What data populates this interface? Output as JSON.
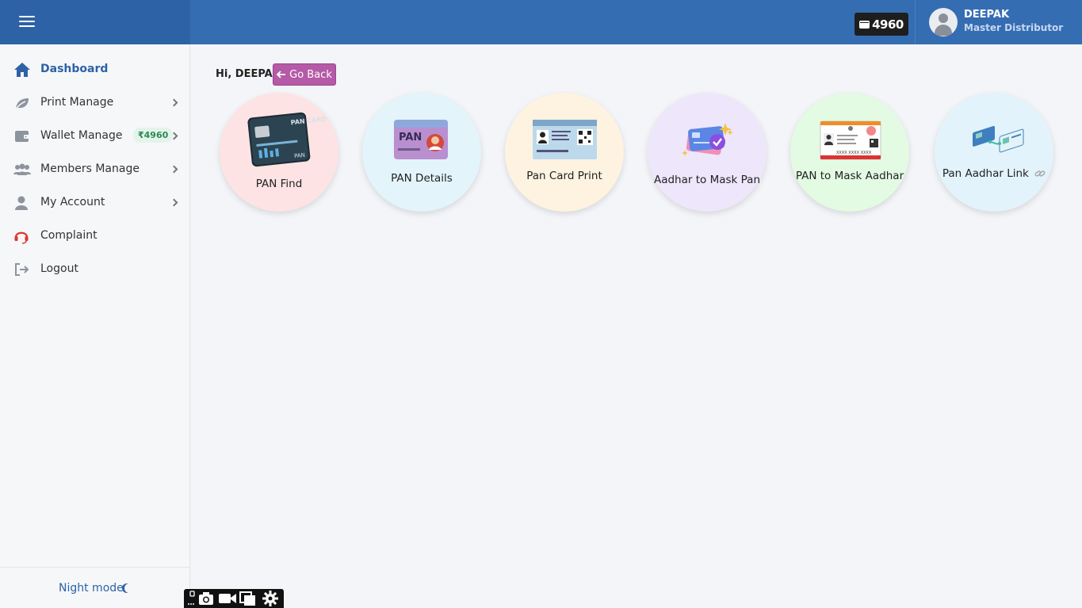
{
  "topbar": {
    "menu_icon": "hamburger-icon",
    "wallet_balance": "4960",
    "user_name": "DEEPAK",
    "user_role": "Master Distributor"
  },
  "sidebar": {
    "items": [
      {
        "label": "Dashboard",
        "icon": "home-icon",
        "active": true
      },
      {
        "label": "Print Manage",
        "icon": "leaf-icon"
      },
      {
        "label": "Wallet Manage",
        "icon": "wallet-icon",
        "badge": "₹4960"
      },
      {
        "label": "Members Manage",
        "icon": "users-icon"
      },
      {
        "label": "My Account",
        "icon": "user-icon"
      },
      {
        "label": "Complaint",
        "icon": "headset-icon"
      },
      {
        "label": "Logout",
        "icon": "logout-icon"
      }
    ],
    "night_mode_label": "Night mode"
  },
  "main": {
    "greeting": "Hi, DEEPAK",
    "go_back_label": "Go Back",
    "services": [
      {
        "label": "PAN Find",
        "bg": "#fde3e3",
        "card_text_top": "PAN CARD",
        "card_text_bottom": "PAN"
      },
      {
        "label": "PAN Details",
        "bg": "#e3f4fb",
        "card_text": "PAN"
      },
      {
        "label": "Pan Card Print",
        "bg": "#fdf3e0"
      },
      {
        "label": "Aadhar to Mask Pan",
        "bg": "#eee6fb"
      },
      {
        "label": "PAN to Mask Aadhar",
        "bg": "#e3fae3",
        "card_text": "XXXX XXXX XXXX"
      },
      {
        "label": "Pan Aadhar Link",
        "bg": "#e3f3fb"
      }
    ]
  },
  "colors": {
    "topbar": "#356db3",
    "active_nav": "#2d62a7",
    "go_back": "#b55aa6",
    "wallet_badge_text": "#2a8a55"
  }
}
